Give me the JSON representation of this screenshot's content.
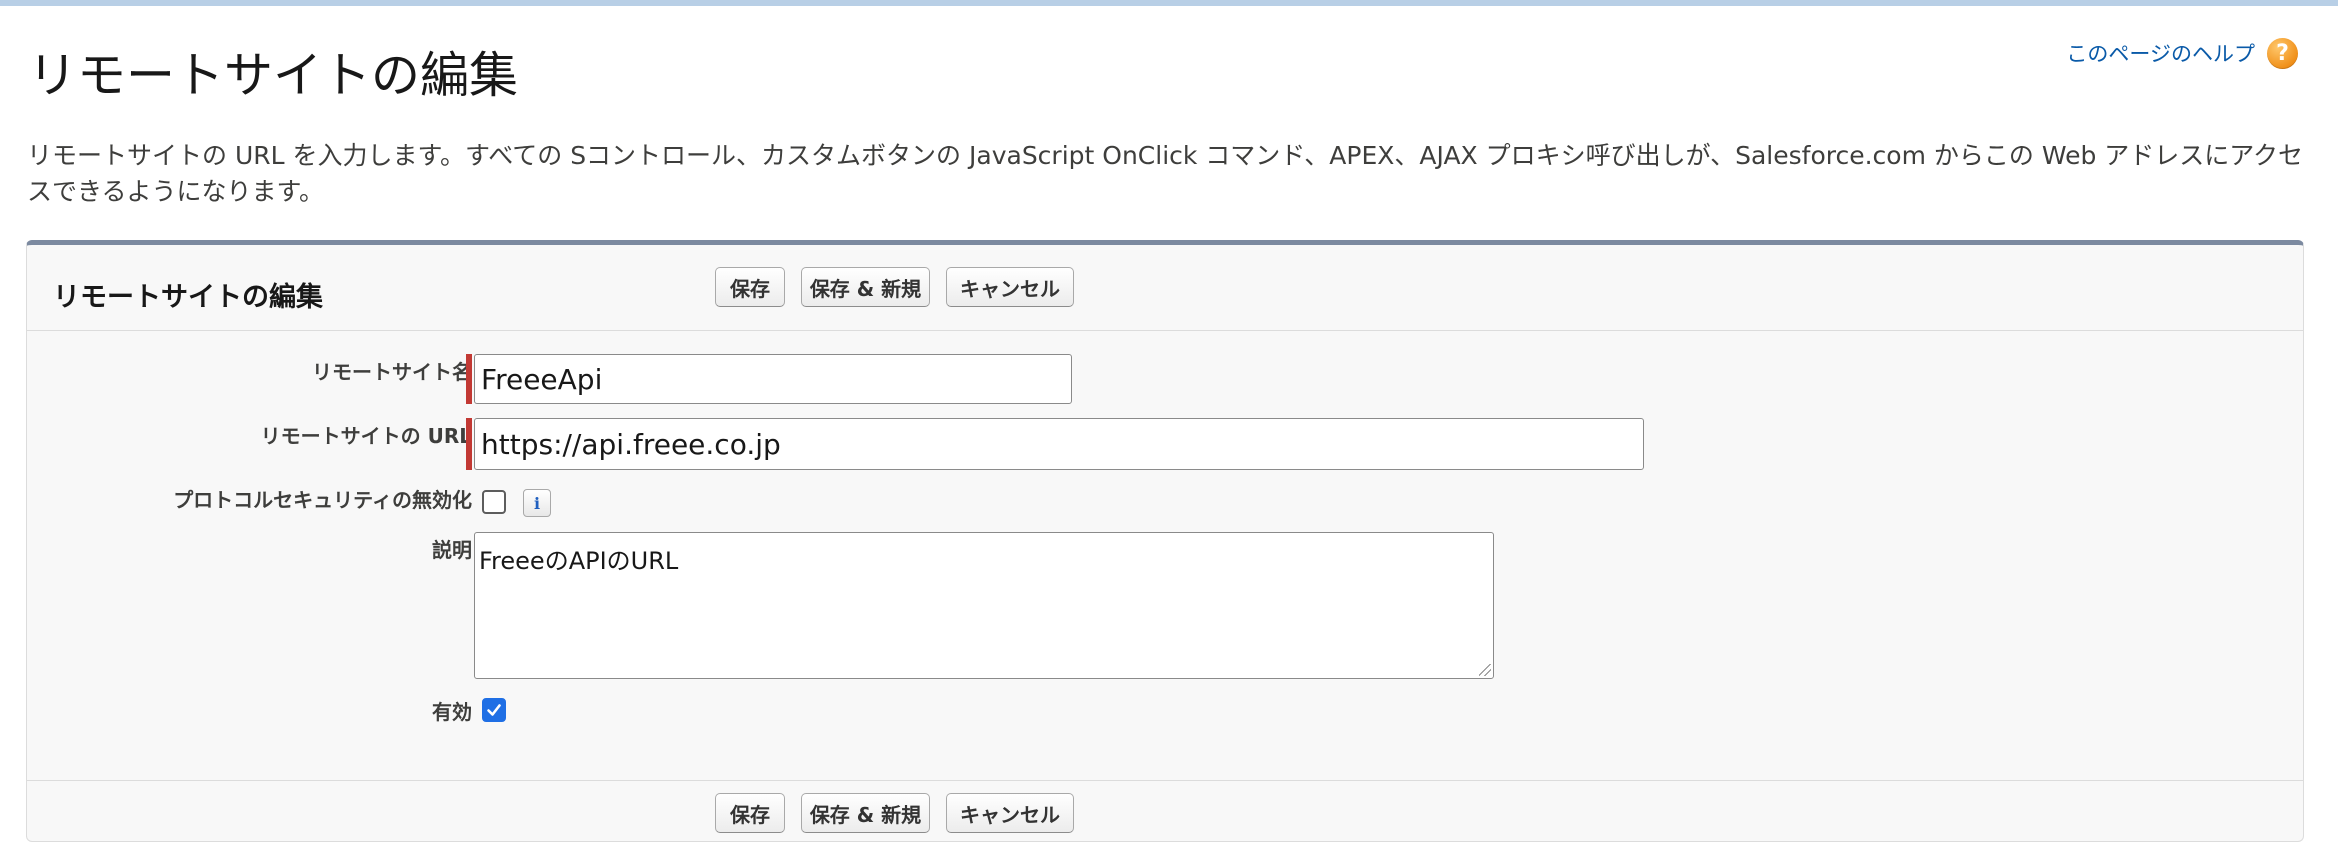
{
  "page": {
    "title": "リモートサイトの編集",
    "help_label": "このページのヘルプ",
    "help_icon": "question-icon",
    "description": "リモートサイトの URL を入力します。すべての Sコントロール、カスタムボタンの JavaScript OnClick コマンド、APEX、AJAX プロキシ呼び出しが、Salesforce.com からこの Web アドレスにアクセスできるようになります。"
  },
  "panel": {
    "title": "リモートサイトの編集",
    "buttons": {
      "save": "保存",
      "save_new": "保存 & 新規",
      "cancel": "キャンセル"
    }
  },
  "form": {
    "name": {
      "label": "リモートサイト名",
      "value": "FreeeApi",
      "required": true
    },
    "url": {
      "label": "リモートサイトの URL",
      "value": "https://api.freee.co.jp",
      "required": true
    },
    "disable_protocol_security": {
      "label": "プロトコルセキュリティの無効化",
      "checked": false,
      "info_icon": "info-icon"
    },
    "description": {
      "label": "説明",
      "value": "FreeeのAPIのURL"
    },
    "active": {
      "label": "有効",
      "checked": true
    }
  },
  "colors": {
    "accent": "#1f6fe5",
    "required": "#c23934",
    "link": "#0a5aa8",
    "panel_border_top": "#7c8aa0"
  }
}
